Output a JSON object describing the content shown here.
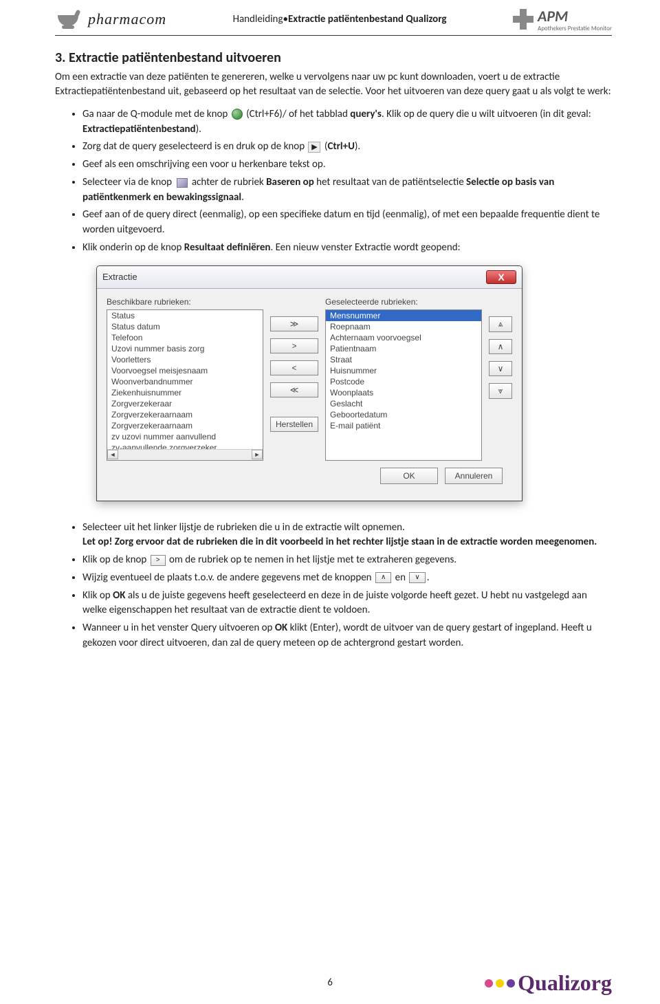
{
  "header": {
    "brand": "pharmacom",
    "mid_prefix": "Handleiding",
    "mid_bullet": "•",
    "mid_bold": "Extractie patiëntenbestand Qualizorg",
    "apm_title": "APM",
    "apm_sub": "Apothekers Prestatie Monitor"
  },
  "section_title": "3. Extractie patiëntenbestand uitvoeren",
  "intro": "Om een extractie van deze patiënten te genereren, welke u vervolgens naar uw pc kunt downloaden, voert u de extractie Extractiepatiëntenbestand uit, gebaseerd op het resultaat van de selectie. Voor het uitvoeren van deze query gaat u als volgt te werk:",
  "bullets1": {
    "b1a": "Ga naar de Q-module met de knop ",
    "b1b": " (Ctrl+F6)/ of het tabblad ",
    "b1c": "query's",
    "b1d": ". Klik op de query die u wilt uitvoeren (in dit geval: ",
    "b1e": "Extractiepatiëntenbestand",
    "b1f": ").",
    "b2a": "Zorg dat de query geselecteerd is en druk op de knop ",
    "b2b": " (",
    "b2c": "Ctrl+U",
    "b2d": ").",
    "b3": "Geef als een omschrijving een voor u herkenbare tekst op.",
    "b4a": "Selecteer via de knop ",
    "b4b": " achter de rubriek ",
    "b4c": "Baseren op",
    "b4d": " het resultaat van de patiëntselectie ",
    "b4e": "Selectie op basis van patiëntkenmerk en bewakingssignaal",
    "b4f": ".",
    "b5": "Geef aan of de query direct (eenmalig), op een specifieke datum en tijd (eenmalig), of met een bepaalde frequentie dient te worden uitgevoerd.",
    "b6a": "Klik onderin op de knop ",
    "b6b": "Resultaat definiëren",
    "b6c": ". Een nieuw venster Extractie wordt geopend:"
  },
  "dialog": {
    "title": "Extractie",
    "close": "X",
    "left_label": "Beschikbare rubrieken:",
    "right_label": "Geselecteerde rubrieken:",
    "left_items": [
      "Status",
      "Status datum",
      "Telefoon",
      "Uzovi nummer basis zorg",
      "Voorletters",
      "Voorvoegsel meisjesnaam",
      "Woonverbandnummer",
      "Ziekenhuisnummer",
      "Zorgverzekeraar",
      "Zorgverzekeraarnaam",
      "Zorgverzekeraarnaam",
      "zv uzovi nummer aanvullend",
      "zv-aanvullende zorgverzeker"
    ],
    "right_items": [
      "Mensnummer",
      "Roepnaam",
      "Achternaam voorvoegsel",
      "Patientnaam",
      "Straat",
      "Huisnummer",
      "Postcode",
      "Woonplaats",
      "Geslacht",
      "Geboortedatum",
      "E-mail patiënt"
    ],
    "mid_btns": {
      "add_all": "≫",
      "add": ">",
      "remove": "<",
      "remove_all": "≪",
      "reset": "Herstellen"
    },
    "right_btns": {
      "top": "⩓",
      "up": "∧",
      "down": "∨",
      "bottom": "⩔"
    },
    "ok": "OK",
    "cancel": "Annuleren",
    "scroll_left": "◄",
    "scroll_right": "►"
  },
  "bullets2": {
    "b1a": "Selecteer uit het linker lijstje de rubrieken die u in de extractie wilt opnemen.",
    "b1b": "Let op!",
    "b1c": " Zorg ervoor dat de rubrieken die in dit voorbeeld in het rechter lijstje staan in de extractie worden meegenomen.",
    "b2a": "Klik op de knop ",
    "b2b": "om de rubriek op te nemen in het lijstje met te extraheren gegevens.",
    "b3a": "Wijzig eventueel de plaats t.o.v. de andere gegevens met de knoppen ",
    "b3b": " en ",
    "b3c": ".",
    "b4a": "Klik op ",
    "b4b": "OK",
    "b4c": " als u de juiste gegevens heeft geselecteerd en deze in de juiste volgorde heeft gezet. U hebt nu vastgelegd aan welke eigenschappen het resultaat van de extractie dient te voldoen.",
    "b5a": "Wanneer u in het venster Query uitvoeren op ",
    "b5b": "OK",
    "b5c": " klikt (Enter), wordt de uitvoer van de query gestart of ingepland. Heeft u gekozen voor direct uitvoeren, dan zal de query meteen op de achtergrond gestart worden."
  },
  "small_btns": {
    "gt": ">",
    "up": "∧",
    "down": "∨"
  },
  "page_number": "6",
  "footer_brand": "Qualizorg"
}
